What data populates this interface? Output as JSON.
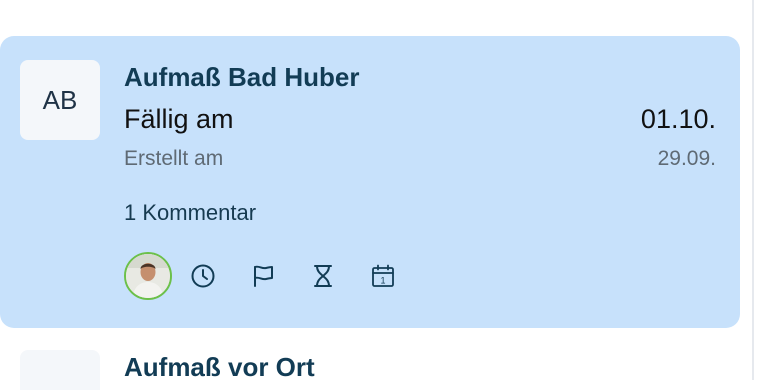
{
  "task_card": {
    "initials": "AB",
    "title": "Aufmaß Bad Huber",
    "due_label": "Fällig am",
    "due_date": "01.10.",
    "created_label": "Erstellt am",
    "created_date": "29.09.",
    "comments_label": "1 Kommentar",
    "background_color": "#c7e1fb",
    "actions": [
      {
        "icon": "clock-icon"
      },
      {
        "icon": "flag-icon"
      },
      {
        "icon": "hourglass-icon"
      },
      {
        "icon": "calendar-icon",
        "text": "1"
      }
    ]
  },
  "next_card": {
    "title": "Aufmaß vor Ort"
  }
}
